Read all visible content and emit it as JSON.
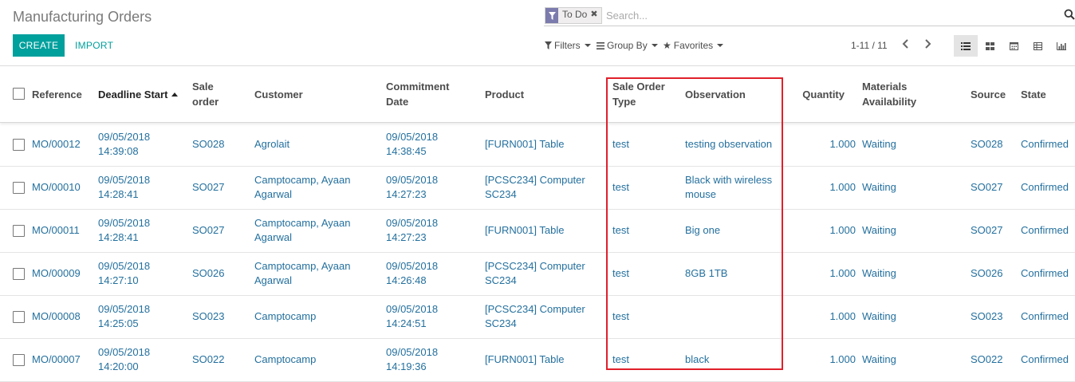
{
  "page": {
    "title": "Manufacturing Orders",
    "create_label": "CREATE",
    "import_label": "IMPORT"
  },
  "search": {
    "facet_label": "To Do",
    "placeholder": "Search..."
  },
  "toolbar": {
    "filters_label": "Filters",
    "groupby_label": "Group By",
    "favorites_label": "Favorites",
    "pager_text": "1-11 / 11"
  },
  "columns": {
    "reference": "Reference",
    "deadline_1": "Deadline Start",
    "sale_order_1": "Sale",
    "sale_order_2": "order",
    "customer": "Customer",
    "commitment_1": "Commitment",
    "commitment_2": "Date",
    "product": "Product",
    "so_type_1": "Sale Order",
    "so_type_2": "Type",
    "observation": "Observation",
    "quantity": "Quantity",
    "materials_1": "Materials",
    "materials_2": "Availability",
    "source": "Source",
    "state": "State"
  },
  "rows": [
    {
      "ref": "MO/00012",
      "deadline_date": "09/05/2018",
      "deadline_time": "14:39:08",
      "so": "SO028",
      "cust_1": "Agrolait",
      "cust_2": "",
      "commit_date": "09/05/2018",
      "commit_time": "14:38:45",
      "prod_1": "[FURN001] Table",
      "prod_2": "",
      "so_type": "test",
      "obs_1": "testing observation",
      "obs_2": "",
      "qty": "1.000",
      "avail": "Waiting",
      "source": "SO028",
      "state": "Confirmed"
    },
    {
      "ref": "MO/00010",
      "deadline_date": "09/05/2018",
      "deadline_time": "14:28:41",
      "so": "SO027",
      "cust_1": "Camptocamp, Ayaan",
      "cust_2": "Agarwal",
      "commit_date": "09/05/2018",
      "commit_time": "14:27:23",
      "prod_1": "[PCSC234] Computer",
      "prod_2": "SC234",
      "so_type": "test",
      "obs_1": "Black with wireless",
      "obs_2": "mouse",
      "qty": "1.000",
      "avail": "Waiting",
      "source": "SO027",
      "state": "Confirmed"
    },
    {
      "ref": "MO/00011",
      "deadline_date": "09/05/2018",
      "deadline_time": "14:28:41",
      "so": "SO027",
      "cust_1": "Camptocamp, Ayaan",
      "cust_2": "Agarwal",
      "commit_date": "09/05/2018",
      "commit_time": "14:27:23",
      "prod_1": "[FURN001] Table",
      "prod_2": "",
      "so_type": "test",
      "obs_1": "Big one",
      "obs_2": "",
      "qty": "1.000",
      "avail": "Waiting",
      "source": "SO027",
      "state": "Confirmed"
    },
    {
      "ref": "MO/00009",
      "deadline_date": "09/05/2018",
      "deadline_time": "14:27:10",
      "so": "SO026",
      "cust_1": "Camptocamp, Ayaan",
      "cust_2": "Agarwal",
      "commit_date": "09/05/2018",
      "commit_time": "14:26:48",
      "prod_1": "[PCSC234] Computer",
      "prod_2": "SC234",
      "so_type": "test",
      "obs_1": "8GB 1TB",
      "obs_2": "",
      "qty": "1.000",
      "avail": "Waiting",
      "source": "SO026",
      "state": "Confirmed"
    },
    {
      "ref": "MO/00008",
      "deadline_date": "09/05/2018",
      "deadline_time": "14:25:05",
      "so": "SO023",
      "cust_1": "Camptocamp",
      "cust_2": "",
      "commit_date": "09/05/2018",
      "commit_time": "14:24:51",
      "prod_1": "[PCSC234] Computer",
      "prod_2": "SC234",
      "so_type": "test",
      "obs_1": "",
      "obs_2": "",
      "qty": "1.000",
      "avail": "Waiting",
      "source": "SO023",
      "state": "Confirmed"
    },
    {
      "ref": "MO/00007",
      "deadline_date": "09/05/2018",
      "deadline_time": "14:20:00",
      "so": "SO022",
      "cust_1": "Camptocamp",
      "cust_2": "",
      "commit_date": "09/05/2018",
      "commit_time": "14:19:36",
      "prod_1": "[FURN001] Table",
      "prod_2": "",
      "so_type": "test",
      "obs_1": "black",
      "obs_2": "",
      "qty": "1.000",
      "avail": "Waiting",
      "source": "SO022",
      "state": "Confirmed"
    }
  ],
  "icons": {
    "filter_facet": "filter-icon",
    "facet_remove": "close-icon",
    "search": "search-icon",
    "filters": "filter-icon",
    "groupby": "bars-icon",
    "favorites": "star-icon",
    "prev": "chevron-left-icon",
    "next": "chevron-right-icon",
    "views": [
      "list-view-icon",
      "kanban-view-icon",
      "calendar-view-icon",
      "pivot-view-icon",
      "graph-view-icon"
    ]
  },
  "colors": {
    "primary": "#00a09d",
    "link": "#24709e",
    "facet": "#7c7bad",
    "highlight": "#e0202a"
  }
}
